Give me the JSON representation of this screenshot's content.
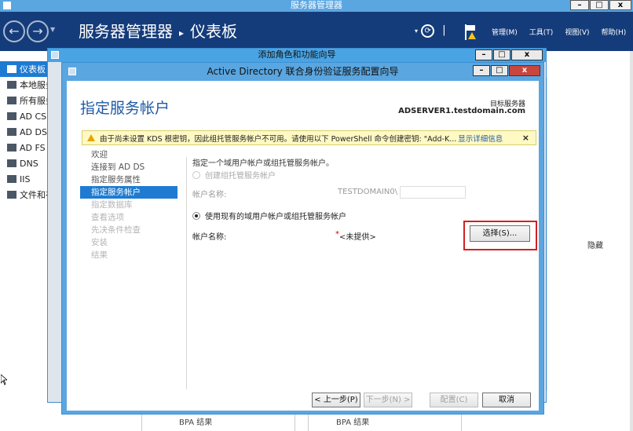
{
  "server_manager": {
    "window_title": "服务器管理器",
    "breadcrumb": {
      "app": "服务器管理器",
      "page": "仪表板"
    },
    "menus": [
      "管理(M)",
      "工具(T)",
      "视图(V)",
      "帮助(H)"
    ],
    "left_nav": [
      {
        "label": "仪表板",
        "active": true
      },
      {
        "label": "本地服务器"
      },
      {
        "label": "所有服务器"
      },
      {
        "label": "AD CS"
      },
      {
        "label": "AD DS"
      },
      {
        "label": "AD FS"
      },
      {
        "label": "DNS"
      },
      {
        "label": "IIS"
      },
      {
        "label": "文件和存储服务"
      }
    ],
    "hide_label": "隐藏",
    "bpa_left": "BPA 结果",
    "bpa_right": "BPA 结果"
  },
  "add_roles_wizard": {
    "title": "添加角色和功能向导"
  },
  "adfs_wizard": {
    "title": "Active Directory 联合身份验证服务配置向导",
    "heading": "指定服务帐户",
    "destination_label": "目标服务器",
    "destination_value": "ADSERVER1.testdomain.com",
    "warning": {
      "text": "由于尚未设置 KDS 根密钥，因此组托管服务帐户不可用。请使用以下 PowerShell 命令创建密钥: \"Add-K...",
      "more_link": "显示详细信息",
      "close": "×"
    },
    "steps": [
      {
        "label": "欢迎",
        "state": "normal"
      },
      {
        "label": "连接到 AD DS",
        "state": "normal"
      },
      {
        "label": "指定服务属性",
        "state": "normal"
      },
      {
        "label": "指定服务帐户",
        "state": "active"
      },
      {
        "label": "指定数据库",
        "state": "disabled"
      },
      {
        "label": "查看选项",
        "state": "disabled"
      },
      {
        "label": "先决条件检查",
        "state": "disabled"
      },
      {
        "label": "安装",
        "state": "disabled"
      },
      {
        "label": "结果",
        "state": "disabled"
      }
    ],
    "instruction": "指定一个域用户帐户或组托管服务帐户。",
    "option_create": {
      "label": "创建组托管服务帐户",
      "checked": false,
      "enabled": false,
      "account_label": "帐户名称:",
      "domain_prefix": "TESTDOMAIN0\\",
      "account_value": ""
    },
    "option_existing": {
      "label": "使用现有的域用户帐户或组托管服务帐户",
      "checked": true,
      "account_label": "帐户名称:",
      "required_marker": "*",
      "account_value": "<未提供>",
      "select_button": "选择(S)..."
    },
    "footer": {
      "prev": "< 上一步(P)",
      "next": "下一步(N) >",
      "configure": "配置(C)",
      "cancel": "取消"
    }
  }
}
